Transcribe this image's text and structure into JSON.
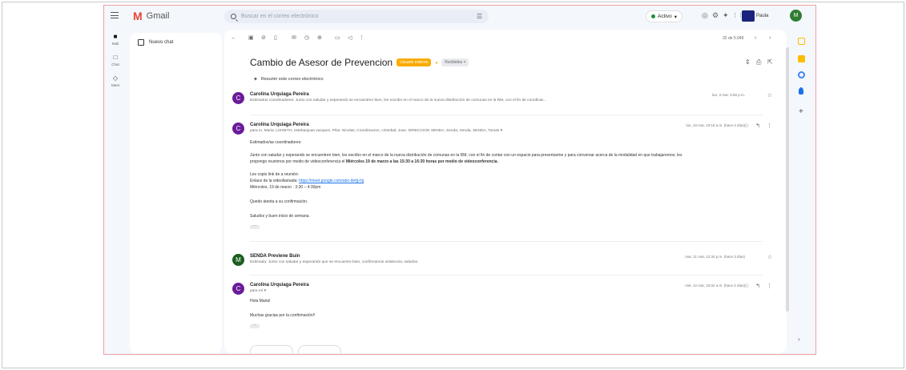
{
  "app": {
    "logo_glyph": "M",
    "logo_text": "Gmail",
    "search_placeholder": "Buscar en el correo electrónico",
    "status_label": "Activo",
    "status_color": "#1e8e3e",
    "account_name": "Paula",
    "avatar_letter": "M"
  },
  "rail": [
    {
      "label": "Mail",
      "icon": "mail-icon",
      "glyph": "■"
    },
    {
      "label": "Chat",
      "icon": "chat-icon",
      "glyph": "□"
    },
    {
      "label": "Meet",
      "icon": "meet-icon",
      "glyph": "◇"
    }
  ],
  "sidebar": {
    "compose_label": "Nuevo chat"
  },
  "thread": {
    "date_range": "32 de 5.049",
    "subject": "Cambio de Asesor de Prevencion",
    "label_primary": "Usuario externo",
    "label_primary_color": "#f9ab00",
    "label_secondary": "Recibidos ×",
    "summary_label": "Resumir este correo electrónico",
    "messages": [
      {
        "avatar": "C",
        "sender": "Carolina Urquiaga Pereira",
        "snippet": "Estimados coordinadores: Junto con saludar y esperando se encuentren bien, les escribo en el marco de la nueva distribución de comunas en la RM, con el fin de coordinar...",
        "date": "lun, 3 mar, 5:56 p.m."
      },
      {
        "avatar": "C",
        "sender": "Carolina Urquiaga Pereira",
        "recipients": "para m, Maria, LISSETH, estebanjuan.vazquez, Pilar, Nicolas, Coordinacion, cristobal, Jose, DIRECCION SENDA, Senda, Senda, SENDA, Tomas ▾",
        "date": "lun, 10 mar, 10:18 a.m. (hace 4 días)",
        "body_greeting": "Estimados/as coordinadores:",
        "body_line1": "Junto con saludar y esperando se encuentren bien, les escribo en el marco de la nueva distribución de comunas en la RM, con el fin de contar con un espacio para presentarme y para conversar acerca de la modalidad en que trabajaremos; les",
        "body_line2_a": "propongo reunirnos por medio de videoconferencia el",
        "body_line2_b": "Miércoles 19 de marzo a las 15:30 a 16:30 horas por medio de videoconferencia.",
        "meeting_title": "Les copio link de a reunión:",
        "meeting_link_label": "Enlace de la videollamada:",
        "meeting_link": "https://meet.google.com/abc-defg-hij",
        "meeting_time": "Miércoles, 19 de marzo · 3:30 – 4:30pm",
        "closing1": "Quedo atenta a su confirmación.",
        "closing2": "Saludos y buen inicio de semana."
      },
      {
        "avatar": "M",
        "sender": "SENDA Previene Buin",
        "snippet": "Estimada: Junto con saludar y esperando que se encuentre bien, confirmamos asistencia, saludos.",
        "date": "mar, 11 mar, 12:34 p.m. (hace 3 días)"
      },
      {
        "avatar": "C",
        "sender": "Carolina Urquiaga Pereira",
        "recipients": "para mí ▾",
        "date": "mié, 12 mar, 10:02 a.m. (hace 2 días)",
        "body_greeting": "Hola Maria!",
        "closing1": "Muchas gracias por la confirmación!!"
      }
    ]
  },
  "right_rail": [
    {
      "icon": "calendar-icon",
      "color": "#fbbc04"
    },
    {
      "icon": "keep-icon",
      "color": "#fbbc04"
    },
    {
      "icon": "tasks-icon",
      "color": "#4285f4"
    },
    {
      "icon": "contacts-icon",
      "color": "#1a73e8"
    }
  ]
}
